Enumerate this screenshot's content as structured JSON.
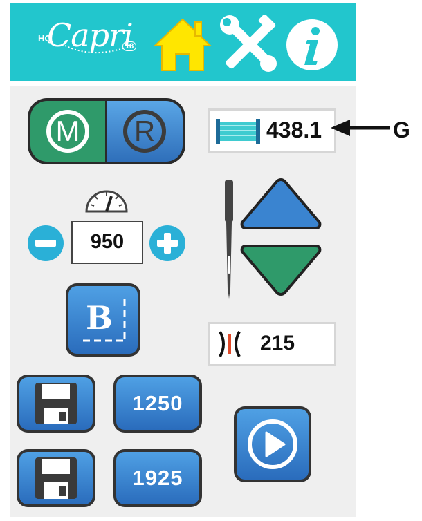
{
  "header": {
    "logo_prefix": "HQ",
    "logo_name": "Capri",
    "logo_model": "18",
    "icons": [
      "home-icon",
      "tools-icon",
      "info-icon"
    ],
    "color": "#22c6cd"
  },
  "mode_toggle": {
    "manual_label": "M",
    "regulated_label": "R",
    "manual_color": "#2f9a6a",
    "regulated_color": "#3a84d0"
  },
  "thread": {
    "value": "438.1",
    "callout": "G"
  },
  "speed": {
    "value": "950",
    "icon": "speedometer-icon"
  },
  "needle": {
    "up_icon": "up-triangle-icon",
    "down_icon": "down-triangle-icon"
  },
  "baste": {
    "label": "B"
  },
  "stitch_counter": {
    "value": "215"
  },
  "presets": [
    {
      "value": "1250"
    },
    {
      "value": "1925"
    }
  ],
  "play": {
    "icon": "play-icon"
  }
}
